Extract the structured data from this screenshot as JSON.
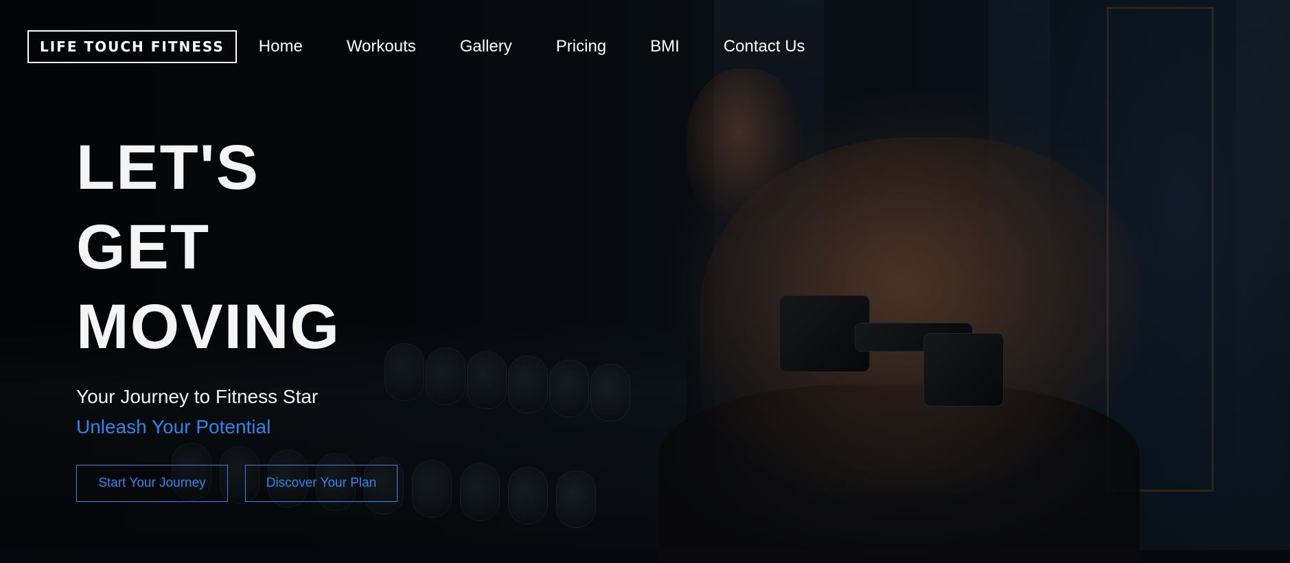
{
  "brand": {
    "logo_text": "LIFE TOUCH FITNESS"
  },
  "nav": {
    "items": [
      {
        "label": "Home"
      },
      {
        "label": "Workouts"
      },
      {
        "label": "Gallery"
      },
      {
        "label": "Pricing"
      },
      {
        "label": "BMI"
      },
      {
        "label": "Contact Us"
      }
    ]
  },
  "hero": {
    "title_lines": [
      "LET'S",
      "GET",
      "MOVING"
    ],
    "subtitle": "Your Journey to Fitness Star",
    "tagline": "Unleash Your Potential",
    "buttons": {
      "start": "Start Your Journey",
      "discover": "Discover Your Plan"
    },
    "background_image": "man-lifting-dumbbell-in-dark-gym"
  },
  "colors": {
    "background": "#05080c",
    "text": "#ffffff",
    "accent": "#2f86e8"
  }
}
